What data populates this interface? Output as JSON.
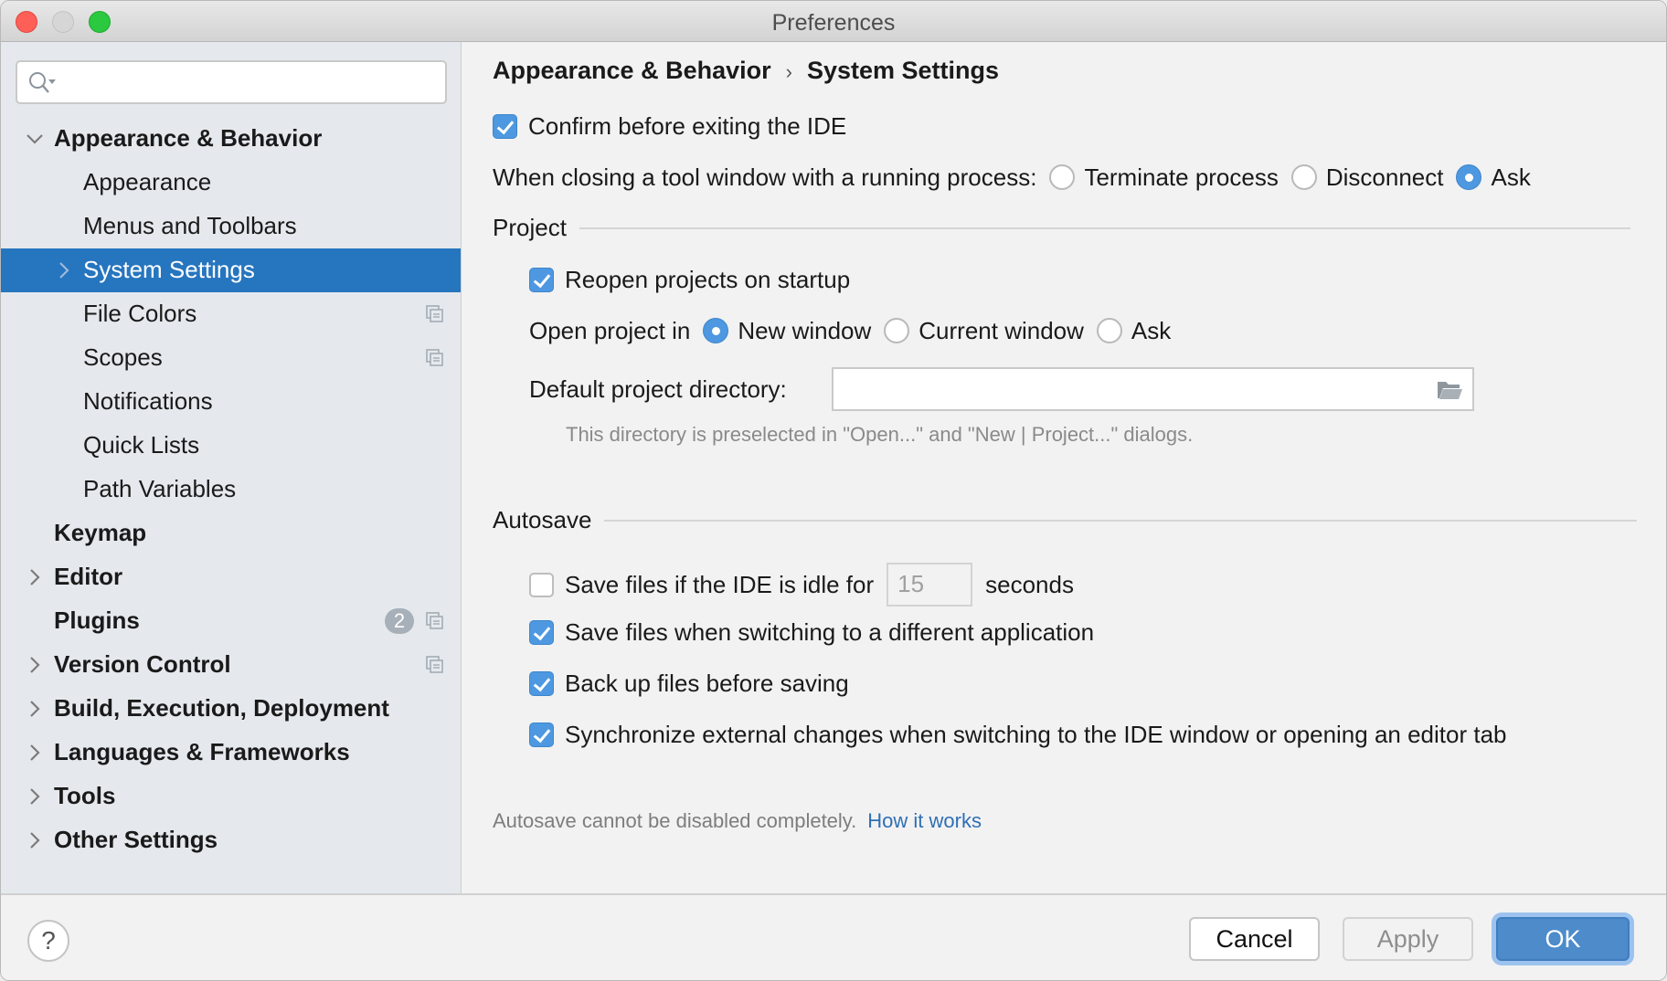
{
  "window": {
    "title": "Preferences"
  },
  "sidebar": {
    "search": {
      "placeholder": "",
      "value": ""
    },
    "items": [
      {
        "label": "Appearance & Behavior",
        "level": 0,
        "expanded": true,
        "has_children": true
      },
      {
        "label": "Appearance",
        "level": 1
      },
      {
        "label": "Menus and Toolbars",
        "level": 1
      },
      {
        "label": "System Settings",
        "level": 1,
        "selected": true,
        "has_children": true
      },
      {
        "label": "File Colors",
        "level": 1,
        "project_icon": true
      },
      {
        "label": "Scopes",
        "level": 1,
        "project_icon": true
      },
      {
        "label": "Notifications",
        "level": 1
      },
      {
        "label": "Quick Lists",
        "level": 1
      },
      {
        "label": "Path Variables",
        "level": 1
      },
      {
        "label": "Keymap",
        "level": 0
      },
      {
        "label": "Editor",
        "level": 0,
        "has_children": true
      },
      {
        "label": "Plugins",
        "level": 0,
        "badge": "2",
        "project_icon": true
      },
      {
        "label": "Version Control",
        "level": 0,
        "has_children": true,
        "project_icon": true
      },
      {
        "label": "Build, Execution, Deployment",
        "level": 0,
        "has_children": true
      },
      {
        "label": "Languages & Frameworks",
        "level": 0,
        "has_children": true
      },
      {
        "label": "Tools",
        "level": 0,
        "has_children": true
      },
      {
        "label": "Other Settings",
        "level": 0,
        "has_children": true
      }
    ]
  },
  "content": {
    "breadcrumb": {
      "parent": "Appearance & Behavior",
      "separator": "›",
      "current": "System Settings"
    },
    "confirm_exit": {
      "label": "Confirm before exiting the IDE",
      "checked": true
    },
    "closing_tool_window": {
      "label": "When closing a tool window with a running process:",
      "options": [
        "Terminate process",
        "Disconnect",
        "Ask"
      ],
      "selected": "Ask"
    },
    "project": {
      "section_title": "Project",
      "reopen": {
        "label": "Reopen projects on startup",
        "checked": true
      },
      "open_in": {
        "label": "Open project in",
        "options": [
          "New window",
          "Current window",
          "Ask"
        ],
        "selected": "New window"
      },
      "default_dir": {
        "label": "Default project directory:",
        "value": "",
        "hint": "This directory is preselected in \"Open...\" and \"New | Project...\" dialogs."
      }
    },
    "autosave": {
      "section_title": "Autosave",
      "idle": {
        "label": "Save files if the IDE is idle for",
        "value": "15",
        "unit": "seconds",
        "checked": false
      },
      "switching": {
        "label": "Save files when switching to a different application",
        "checked": true
      },
      "backup": {
        "label": "Back up files before saving",
        "checked": true
      },
      "sync": {
        "label": "Synchronize external changes when switching to the IDE window or opening an editor tab",
        "checked": true
      },
      "note": "Autosave cannot be disabled completely.",
      "link": "How it works"
    }
  },
  "footer": {
    "help": "?",
    "cancel": "Cancel",
    "apply": "Apply",
    "ok": "OK"
  }
}
